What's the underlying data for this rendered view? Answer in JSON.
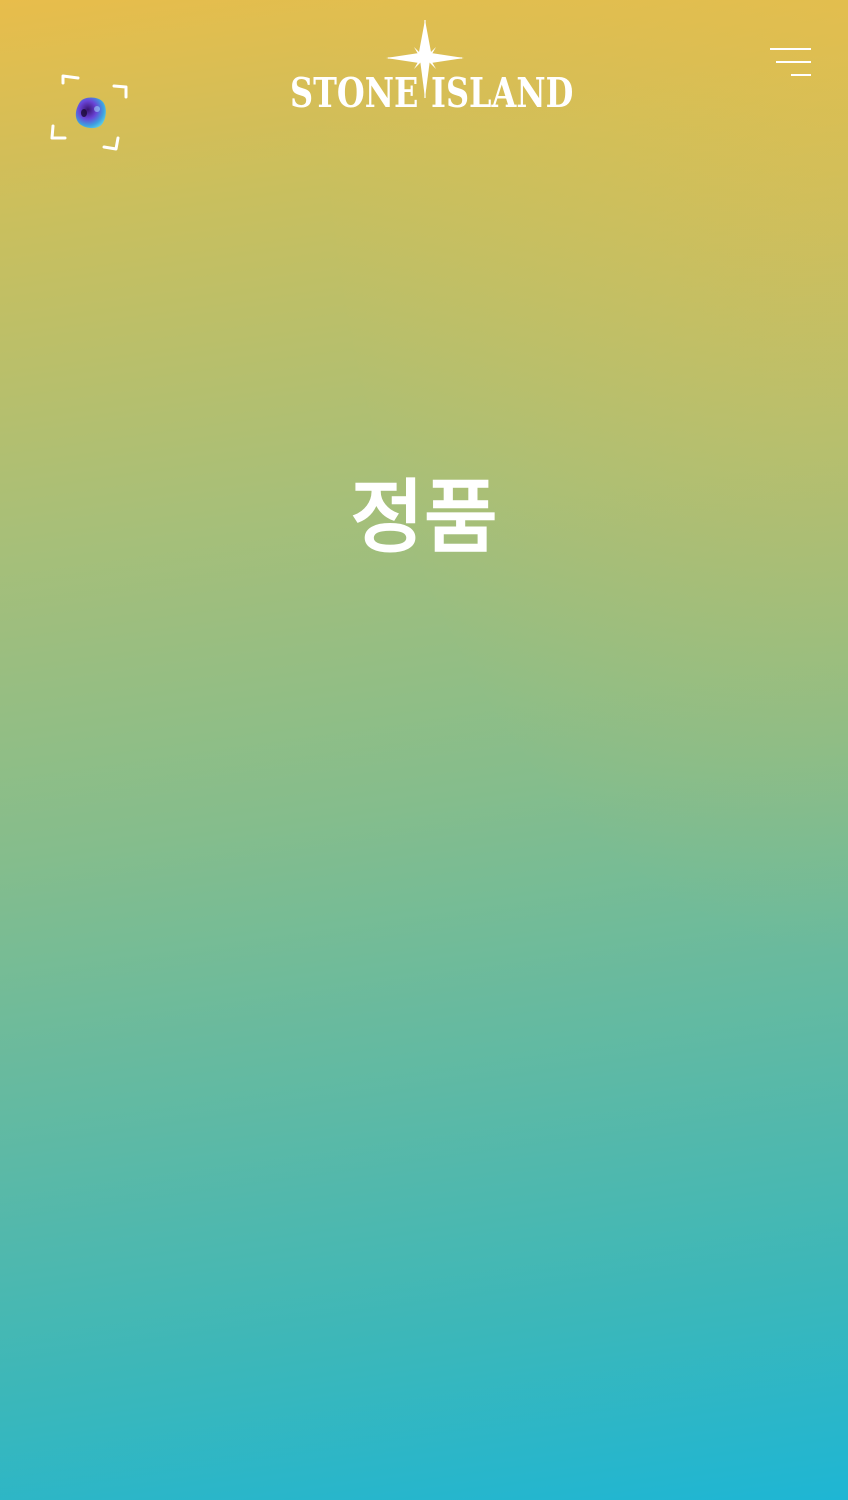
{
  "header": {
    "brand_left": "STONE",
    "brand_right": "ISLAND",
    "scan_icon": "camera-scan-icon",
    "menu_icon": "hamburger-menu-icon",
    "logo_mark": "compass-rose-icon"
  },
  "main": {
    "title": "정품"
  },
  "colors": {
    "gradient_top": "#e8bd4b",
    "gradient_bottom": "#1eb6d4",
    "foreground": "#ffffff"
  }
}
